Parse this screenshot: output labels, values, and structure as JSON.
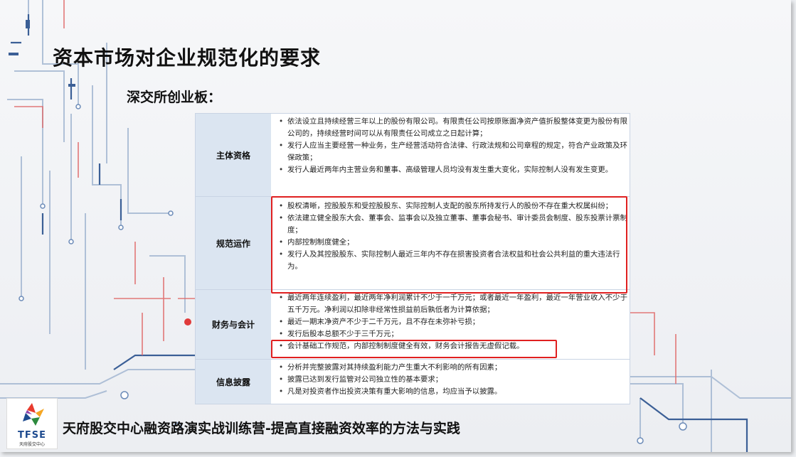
{
  "title": "资本市场对企业规范化的要求",
  "subtitle": "深交所创业板：",
  "rows": [
    {
      "label": "主体资格",
      "items": [
        "依法设立且持续经营三年以上的股份有限公司。有限责任公司按原账面净资产值折股整体变更为股份有限公司的，持续经营时间可以从有限责任公司成立之日起计算；",
        "发行人应当主要经营一种业务，生产经营活动符合法律、行政法规和公司章程的规定，符合产业政策及环保政策；",
        "发行人最近两年内主营业务和董事、高级管理人员均没有发生重大变化，实际控制人没有发生变更。"
      ]
    },
    {
      "label": "规范运作",
      "items": [
        "股权清晰，控股股东和受控股股东、实际控制人支配的股东所持发行人的股份不存在重大权属纠纷；",
        "依法建立健全股东大会、董事会、监事会以及独立董事、董事会秘书、审计委员会制度、股东投票计票制度；",
        "内部控制制度健全；",
        "发行人及其控股股东、实际控制人最近三年内不存在损害投资者合法权益和社会公共利益的重大违法行为。"
      ]
    },
    {
      "label": "财务与会计",
      "items": [
        "最近两年连续盈利，最近两年净利润累计不少于一千万元；或者最近一年盈利，最近一年营业收入不少于五千万元。净利润以扣除非经常性损益前后孰低者为计算依据；",
        "最近一期末净资产不少于二千万元，且不存在未弥补亏损；",
        "发行后股本总额不少于三千万元；",
        "会计基础工作规范，内部控制制度健全有效，财务会计报告无虚假记载。"
      ]
    },
    {
      "label": "信息披露",
      "items": [
        "分析并完整披露对其持续盈利能力产生重大不利影响的所有因素；",
        "披露已达到发行监管对公司独立性的基本要求；",
        "凡是对投资者作出投资决策有重大影响的信息，均应当予以披露。"
      ]
    }
  ],
  "logo": {
    "text": "TFSE",
    "sub": "天府股交中心"
  },
  "footer": "天府股交中心融资路演实战训练营-提高直接融资效率的方法与实践",
  "colors": {
    "label_bg": "#dbe5f1",
    "highlight": "#e02020",
    "circuit_blue": "#4a6fa5",
    "circuit_red": "#e05050"
  }
}
